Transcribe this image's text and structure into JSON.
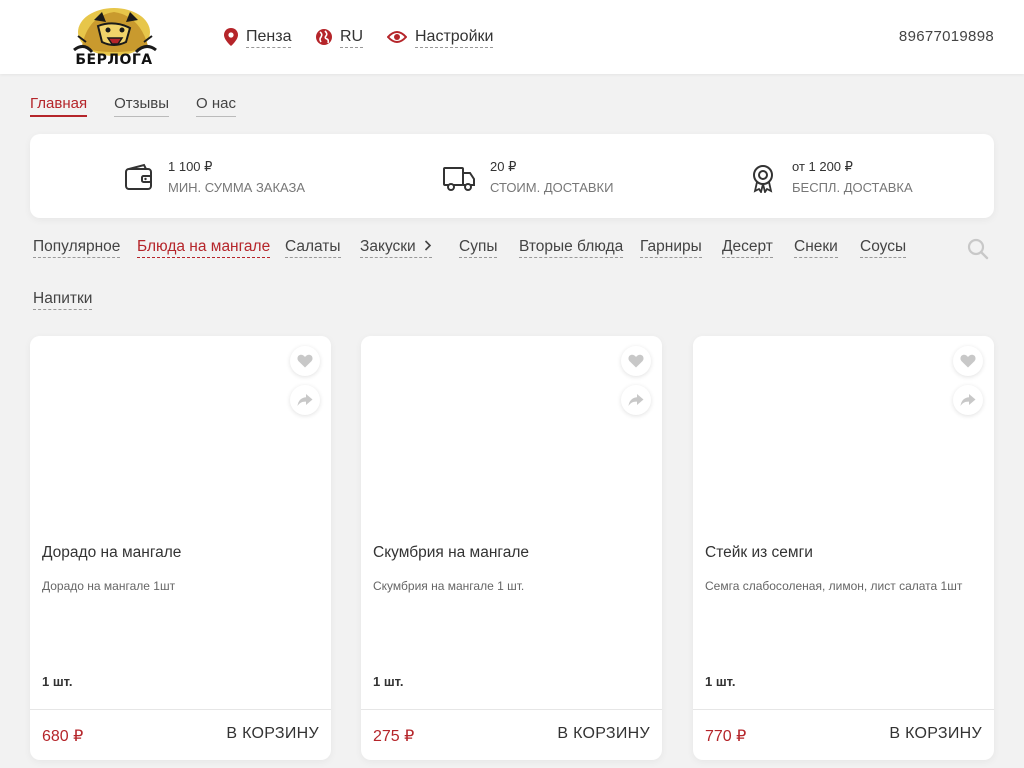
{
  "header": {
    "logo_text": "БЕРЛОГА",
    "city": "Пенза",
    "language": "RU",
    "settings": "Настройки",
    "phone": "89677019898"
  },
  "subnav": [
    "Главная",
    "Отзывы",
    "О нас"
  ],
  "info": [
    {
      "value": "1 100 ₽",
      "label": "МИН. СУММА ЗАКАЗА"
    },
    {
      "value": "20 ₽",
      "label": "СТОИМ. ДОСТАВКИ"
    },
    {
      "value": "от 1 200 ₽",
      "label": "БЕСПЛ. ДОСТАВКА"
    }
  ],
  "categories": [
    "Популярное",
    "Блюда на мангале",
    "Салаты",
    "Закуски",
    "Супы",
    "Вторые блюда",
    "Гарниры",
    "Десерт",
    "Снеки",
    "Соусы",
    "Напитки"
  ],
  "active_category": "Блюда на мангале",
  "products": [
    {
      "title": "Дорадо на мангале",
      "desc": "Дорадо на мангале 1шт",
      "qty": "1 шт.",
      "price": "680 ₽",
      "action": "В КОРЗИНУ"
    },
    {
      "title": "Скумбрия на мангале",
      "desc": "Скумбрия на мангале 1 шт.",
      "qty": "1 шт.",
      "price": "275 ₽",
      "action": "В КОРЗИНУ"
    },
    {
      "title": "Стейк из семги",
      "desc": "Семга слабосоленая, лимон, лист салата 1шт",
      "qty": "1 шт.",
      "price": "770 ₽",
      "action": "В КОРЗИНУ"
    }
  ],
  "colors": {
    "accent": "#b5252a",
    "background": "#f2f2f2",
    "icon_gray": "#c8c8c8"
  },
  "icons": [
    "location-pin-icon",
    "globe-icon",
    "eye-icon",
    "wallet-icon",
    "truck-icon",
    "badge-icon",
    "chevron-right-icon",
    "search-icon",
    "heart-icon",
    "share-icon"
  ]
}
